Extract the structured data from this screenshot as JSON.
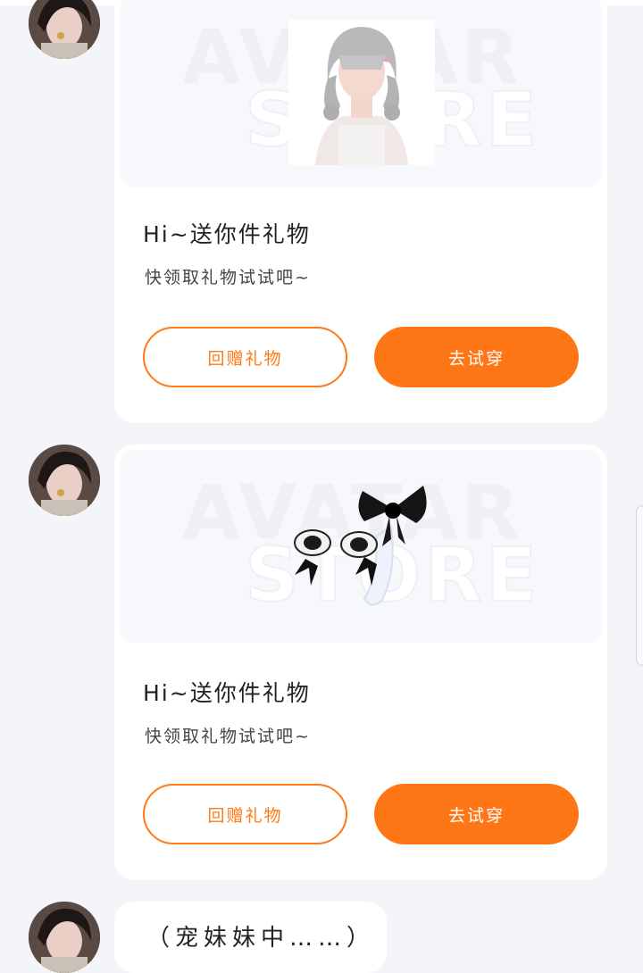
{
  "messages": [
    {
      "title": "Hi~送你件礼物",
      "subtitle": "快领取礼物试试吧~",
      "watermark_line1": "AVATAR",
      "watermark_line2": "STORE",
      "item_icon": "silver-hair-avatar-icon",
      "return_gift_label": "回赠礼物",
      "try_on_label": "去试穿"
    },
    {
      "title": "Hi~送你件礼物",
      "subtitle": "快领取礼物试试吧~",
      "watermark_line1": "AVATAR",
      "watermark_line2": "STORE",
      "item_icon": "bow-ears-tail-icon",
      "return_gift_label": "回赠礼物",
      "try_on_label": "去试穿"
    }
  ],
  "last_message": {
    "text": "（宠妹妹中……）"
  },
  "colors": {
    "accent": "#ff7616",
    "page_bg": "#f4f5f8",
    "card_bg": "#ffffff"
  }
}
